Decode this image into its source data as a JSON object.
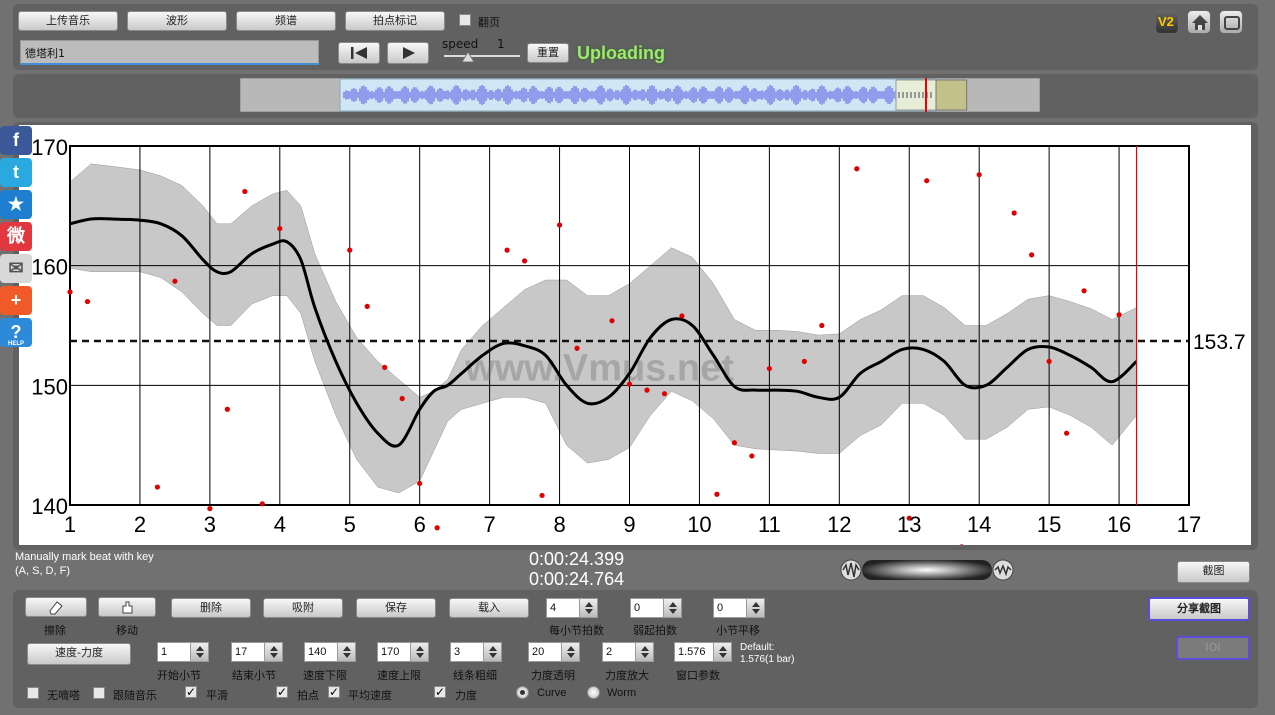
{
  "toolbar": {
    "upload_music": "上传音乐",
    "waveform": "波形",
    "spectrum": "频谱",
    "tap_mark": "拍点标记",
    "page_turn": "翻页",
    "track_name": "德塔利1",
    "speed_label": "speed",
    "speed_value": "1",
    "reset": "重置",
    "status": "Uploading",
    "v2_label": "V2"
  },
  "info": {
    "hint_line1": "Manually mark beat with key",
    "hint_line2": "(A, S, D, F)",
    "time1": "0:00:24.399",
    "time2": "0:00:24.764",
    "screenshot": "截图"
  },
  "controls": {
    "erase": "擦除",
    "move": "移动",
    "delete": "删除",
    "snap": "吸附",
    "save": "保存",
    "load": "载入",
    "beats_per_bar_label": "每小节拍数",
    "beats_per_bar": "4",
    "pickup_label": "弱起拍数",
    "pickup": "0",
    "bar_shift_label": "小节平移",
    "bar_shift": "0",
    "share": "分享截图",
    "ioi": "IOI",
    "tempo_dynamics": "速度-力度",
    "start_bar_label": "开始小节",
    "start_bar": "1",
    "end_bar_label": "结束小节",
    "end_bar": "17",
    "tempo_min_label": "速度下限",
    "tempo_min": "140",
    "tempo_max_label": "速度上限",
    "tempo_max": "170",
    "line_width_label": "线条粗细",
    "line_width": "3",
    "dyn_opacity_label": "力度透明",
    "dyn_opacity": "20",
    "dyn_scale_label": "力度放大",
    "dyn_scale": "2",
    "window_label": "窗口参数",
    "window": "1.576",
    "default_line1": "Default:",
    "default_line2": "1.576(1 bar)",
    "no_ticks": "无嘀嗒",
    "follow_music": "跟随音乐",
    "smooth": "平滑",
    "beats": "拍点",
    "avg_tempo": "平均速度",
    "dynamics": "力度",
    "curve": "Curve",
    "worm": "Worm"
  },
  "social": [
    "f",
    "t",
    "★",
    "微",
    "✉",
    "+",
    "?"
  ],
  "help_label": "HELP",
  "watermark": "www.Vmus.net",
  "chart_data": {
    "type": "line",
    "xlim": [
      1,
      17
    ],
    "ylim": [
      140,
      170
    ],
    "x_ticks": [
      "1",
      "2",
      "3",
      "4",
      "5",
      "6",
      "7",
      "8",
      "9",
      "10",
      "11",
      "12",
      "13",
      "14",
      "15",
      "16",
      "17"
    ],
    "y_ticks": [
      "140",
      "150",
      "160",
      "170"
    ],
    "grid": true,
    "average_tempo": 153.7,
    "average_label": "153.7",
    "playhead_x": 16.25,
    "curve": {
      "x": [
        1,
        1.3,
        1.6,
        2,
        2.3,
        2.6,
        2.9,
        3.1,
        3.3,
        3.6,
        3.9,
        4.1,
        4.3,
        4.5,
        4.8,
        5.1,
        5.4,
        5.7,
        6,
        6.2,
        6.4,
        6.6,
        6.9,
        7.2,
        7.5,
        7.8,
        8.1,
        8.4,
        8.7,
        9,
        9.3,
        9.6,
        9.9,
        10.2,
        10.5,
        10.8,
        11.1,
        11.4,
        11.7,
        12,
        12.3,
        12.6,
        12.9,
        13.2,
        13.5,
        13.8,
        14.1,
        14.4,
        14.7,
        15,
        15.3,
        15.6,
        15.9,
        16.25
      ],
      "y": [
        163.5,
        163.9,
        163.9,
        163.8,
        163.5,
        162.5,
        160.5,
        159.5,
        159.5,
        161,
        161.8,
        162,
        160.5,
        156.5,
        152,
        148.5,
        146,
        145,
        148,
        149.5,
        150,
        151,
        152.5,
        153.5,
        153.3,
        152.5,
        150,
        148.5,
        149,
        151,
        154,
        155.5,
        155,
        152.5,
        149.9,
        149.6,
        149.6,
        149.5,
        149,
        149,
        151,
        152,
        153,
        153,
        152,
        150,
        150,
        151.5,
        153,
        153.2,
        152.5,
        151.5,
        150.3,
        152
      ]
    },
    "band_upper": [
      167,
      168.5,
      168.3,
      168,
      167.5,
      166.7,
      165,
      163.5,
      163.5,
      165,
      166,
      166.3,
      165,
      161,
      157,
      154,
      152,
      150.5,
      149,
      149.5,
      150.5,
      153,
      155,
      156.5,
      158,
      158.8,
      158.8,
      157.5,
      157.5,
      158.5,
      160,
      161.5,
      160.7,
      158.5,
      155.5,
      154.6,
      154.6,
      154.5,
      154.2,
      154.3,
      155.5,
      156.3,
      157.5,
      157.5,
      156.5,
      155,
      155,
      156,
      157.2,
      157.5,
      157,
      156.4,
      155.5,
      156.5
    ],
    "band_lower": [
      159.8,
      159.5,
      159.5,
      159.5,
      159,
      157.8,
      156,
      155,
      155,
      156.8,
      157.5,
      157.5,
      156,
      152,
      147.5,
      143.8,
      141.5,
      141,
      142,
      144.5,
      147,
      148,
      148.5,
      149,
      149,
      148.5,
      145,
      143.5,
      143.8,
      144.8,
      147.5,
      149.5,
      148.7,
      147.2,
      145,
      144.7,
      144.6,
      144.5,
      144.3,
      144.3,
      145.8,
      146.7,
      148.5,
      148.5,
      147.5,
      145.5,
      145.5,
      146.5,
      148,
      148.2,
      147.5,
      146.5,
      145,
      147.5
    ],
    "beat_points": {
      "x": [
        1,
        1.25,
        2.25,
        2.5,
        3,
        3.25,
        3.5,
        3.75,
        4,
        5,
        5.25,
        5.5,
        5.75,
        6,
        6.25,
        7.25,
        7.5,
        7.75,
        8,
        8.25,
        8.75,
        9,
        9.25,
        9.5,
        9.75,
        10.25,
        10.5,
        10.75,
        11,
        11.5,
        11.75,
        12.25,
        12.5,
        13,
        13.25,
        13.75,
        14,
        14.5,
        14.75,
        15,
        15.25,
        15.5,
        16
      ],
      "y": [
        157.8,
        157,
        141.5,
        158.7,
        139.7,
        148,
        166.2,
        140.1,
        163.1,
        161.3,
        156.6,
        151.5,
        148.9,
        141.8,
        138.1,
        161.3,
        160.4,
        140.8,
        163.4,
        153.1,
        155.4,
        150.1,
        149.6,
        149.3,
        155.8,
        140.9,
        145.2,
        144.1,
        151.4,
        152,
        155,
        168.1,
        136.4,
        138.9,
        167.1,
        136.5,
        167.6,
        164.4,
        160.9,
        152,
        146,
        157.9,
        155.9
      ]
    }
  },
  "scrubber": {
    "audio_total_sec": 30,
    "view_start_sec": 0,
    "view_end_sec": 26.1,
    "selection_start_sec": 26.1,
    "selection_end_sec": 28.6
  }
}
